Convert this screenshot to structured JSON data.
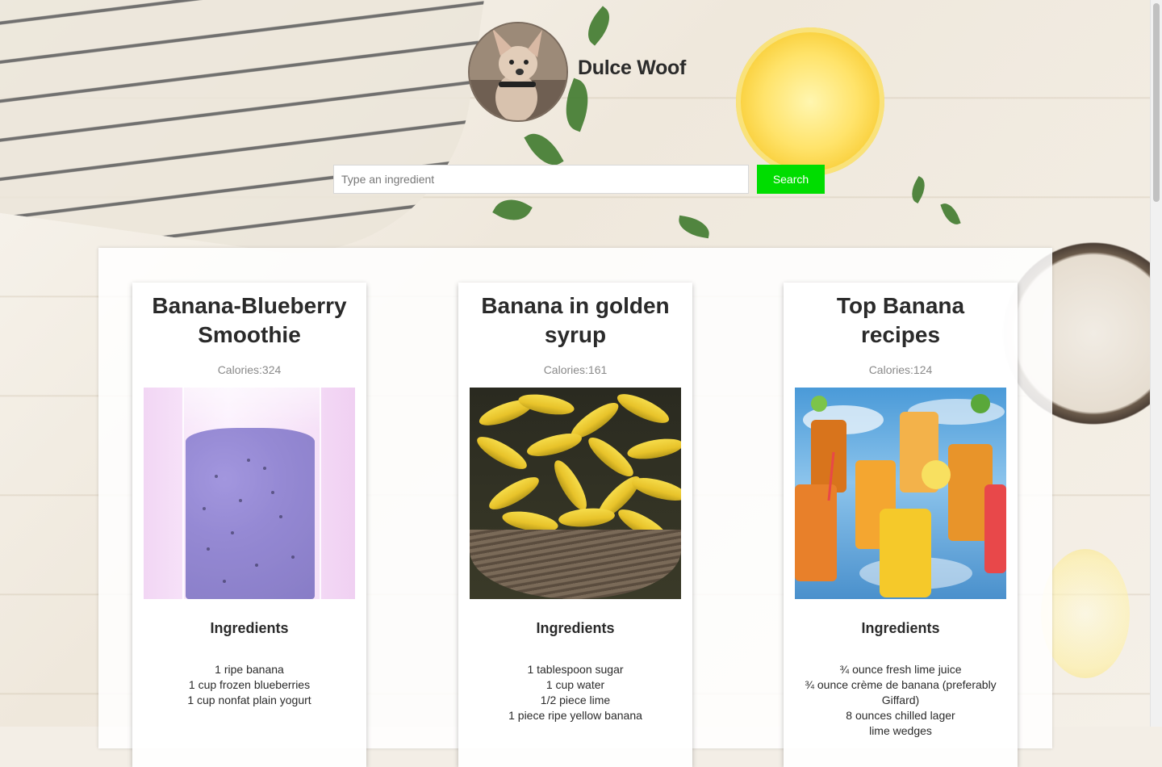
{
  "header": {
    "site_title": "Dulce Woof",
    "avatar_alt": "Dog avatar"
  },
  "search": {
    "placeholder": "Type an ingredient",
    "value": "",
    "button_label": "Search",
    "button_color": "#00dd00"
  },
  "recipes": [
    {
      "title": "Banana-Blueberry Smoothie",
      "calories": "Calories:324",
      "ingredients_heading": "Ingredients",
      "ingredients": [
        "1 ripe banana",
        "1 cup frozen blueberries",
        "1 cup nonfat plain yogurt"
      ]
    },
    {
      "title": "Banana in golden syrup",
      "calories": "Calories:161",
      "ingredients_heading": "Ingredients",
      "ingredients": [
        "1 tablespoon sugar",
        "1 cup water",
        "1/2 piece lime",
        "1 piece ripe yellow banana"
      ]
    },
    {
      "title": "Top Banana recipes",
      "calories": "Calories:124",
      "ingredients_heading": "Ingredients",
      "ingredients": [
        "¾ ounce fresh lime juice",
        "¾ ounce crème de banana (preferably Giffard)",
        "8 ounces chilled lager",
        "lime wedges"
      ]
    }
  ]
}
